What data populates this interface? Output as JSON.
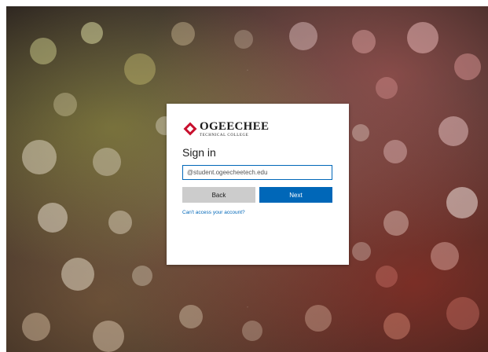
{
  "logo": {
    "main": "OGEECHEE",
    "sub": "TECHNICAL COLLEGE"
  },
  "signin": {
    "title": "Sign in",
    "email_value": "@student.ogeecheetech.edu",
    "back_label": "Back",
    "next_label": "Next",
    "cant_access_link": "Can't access your account?"
  },
  "colors": {
    "accent": "#0067b8",
    "brand_red": "#c8102e",
    "back_button": "#cccccc"
  }
}
